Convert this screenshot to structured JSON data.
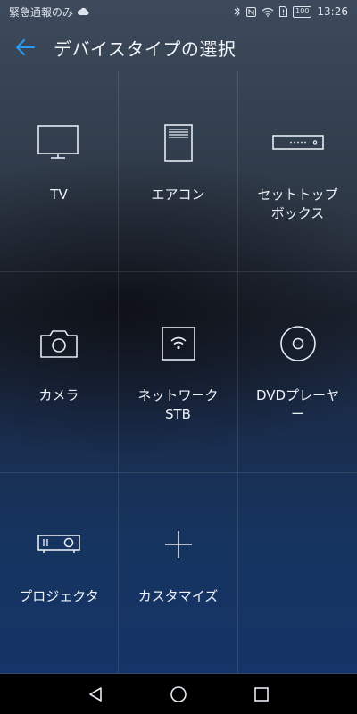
{
  "status_bar": {
    "carrier_text": "緊急通報のみ",
    "battery": "100",
    "time": "13:26"
  },
  "app_bar": {
    "title": "デバイスタイプの選択"
  },
  "devices": [
    {
      "label": "TV",
      "icon": "tv-icon"
    },
    {
      "label": "エアコン",
      "icon": "air-conditioner-icon"
    },
    {
      "label": "セットトップ\nボックス",
      "icon": "set-top-box-icon"
    },
    {
      "label": "カメラ",
      "icon": "camera-icon"
    },
    {
      "label": "ネットワーク\nSTB",
      "icon": "network-stb-icon"
    },
    {
      "label": "DVDプレーヤ\nー",
      "icon": "dvd-player-icon"
    },
    {
      "label": "プロジェクタ",
      "icon": "projector-icon"
    },
    {
      "label": "カスタマイズ",
      "icon": "plus-icon"
    }
  ],
  "colors": {
    "accent": "#2b9af3",
    "icon_stroke": "#e6ebf2"
  }
}
